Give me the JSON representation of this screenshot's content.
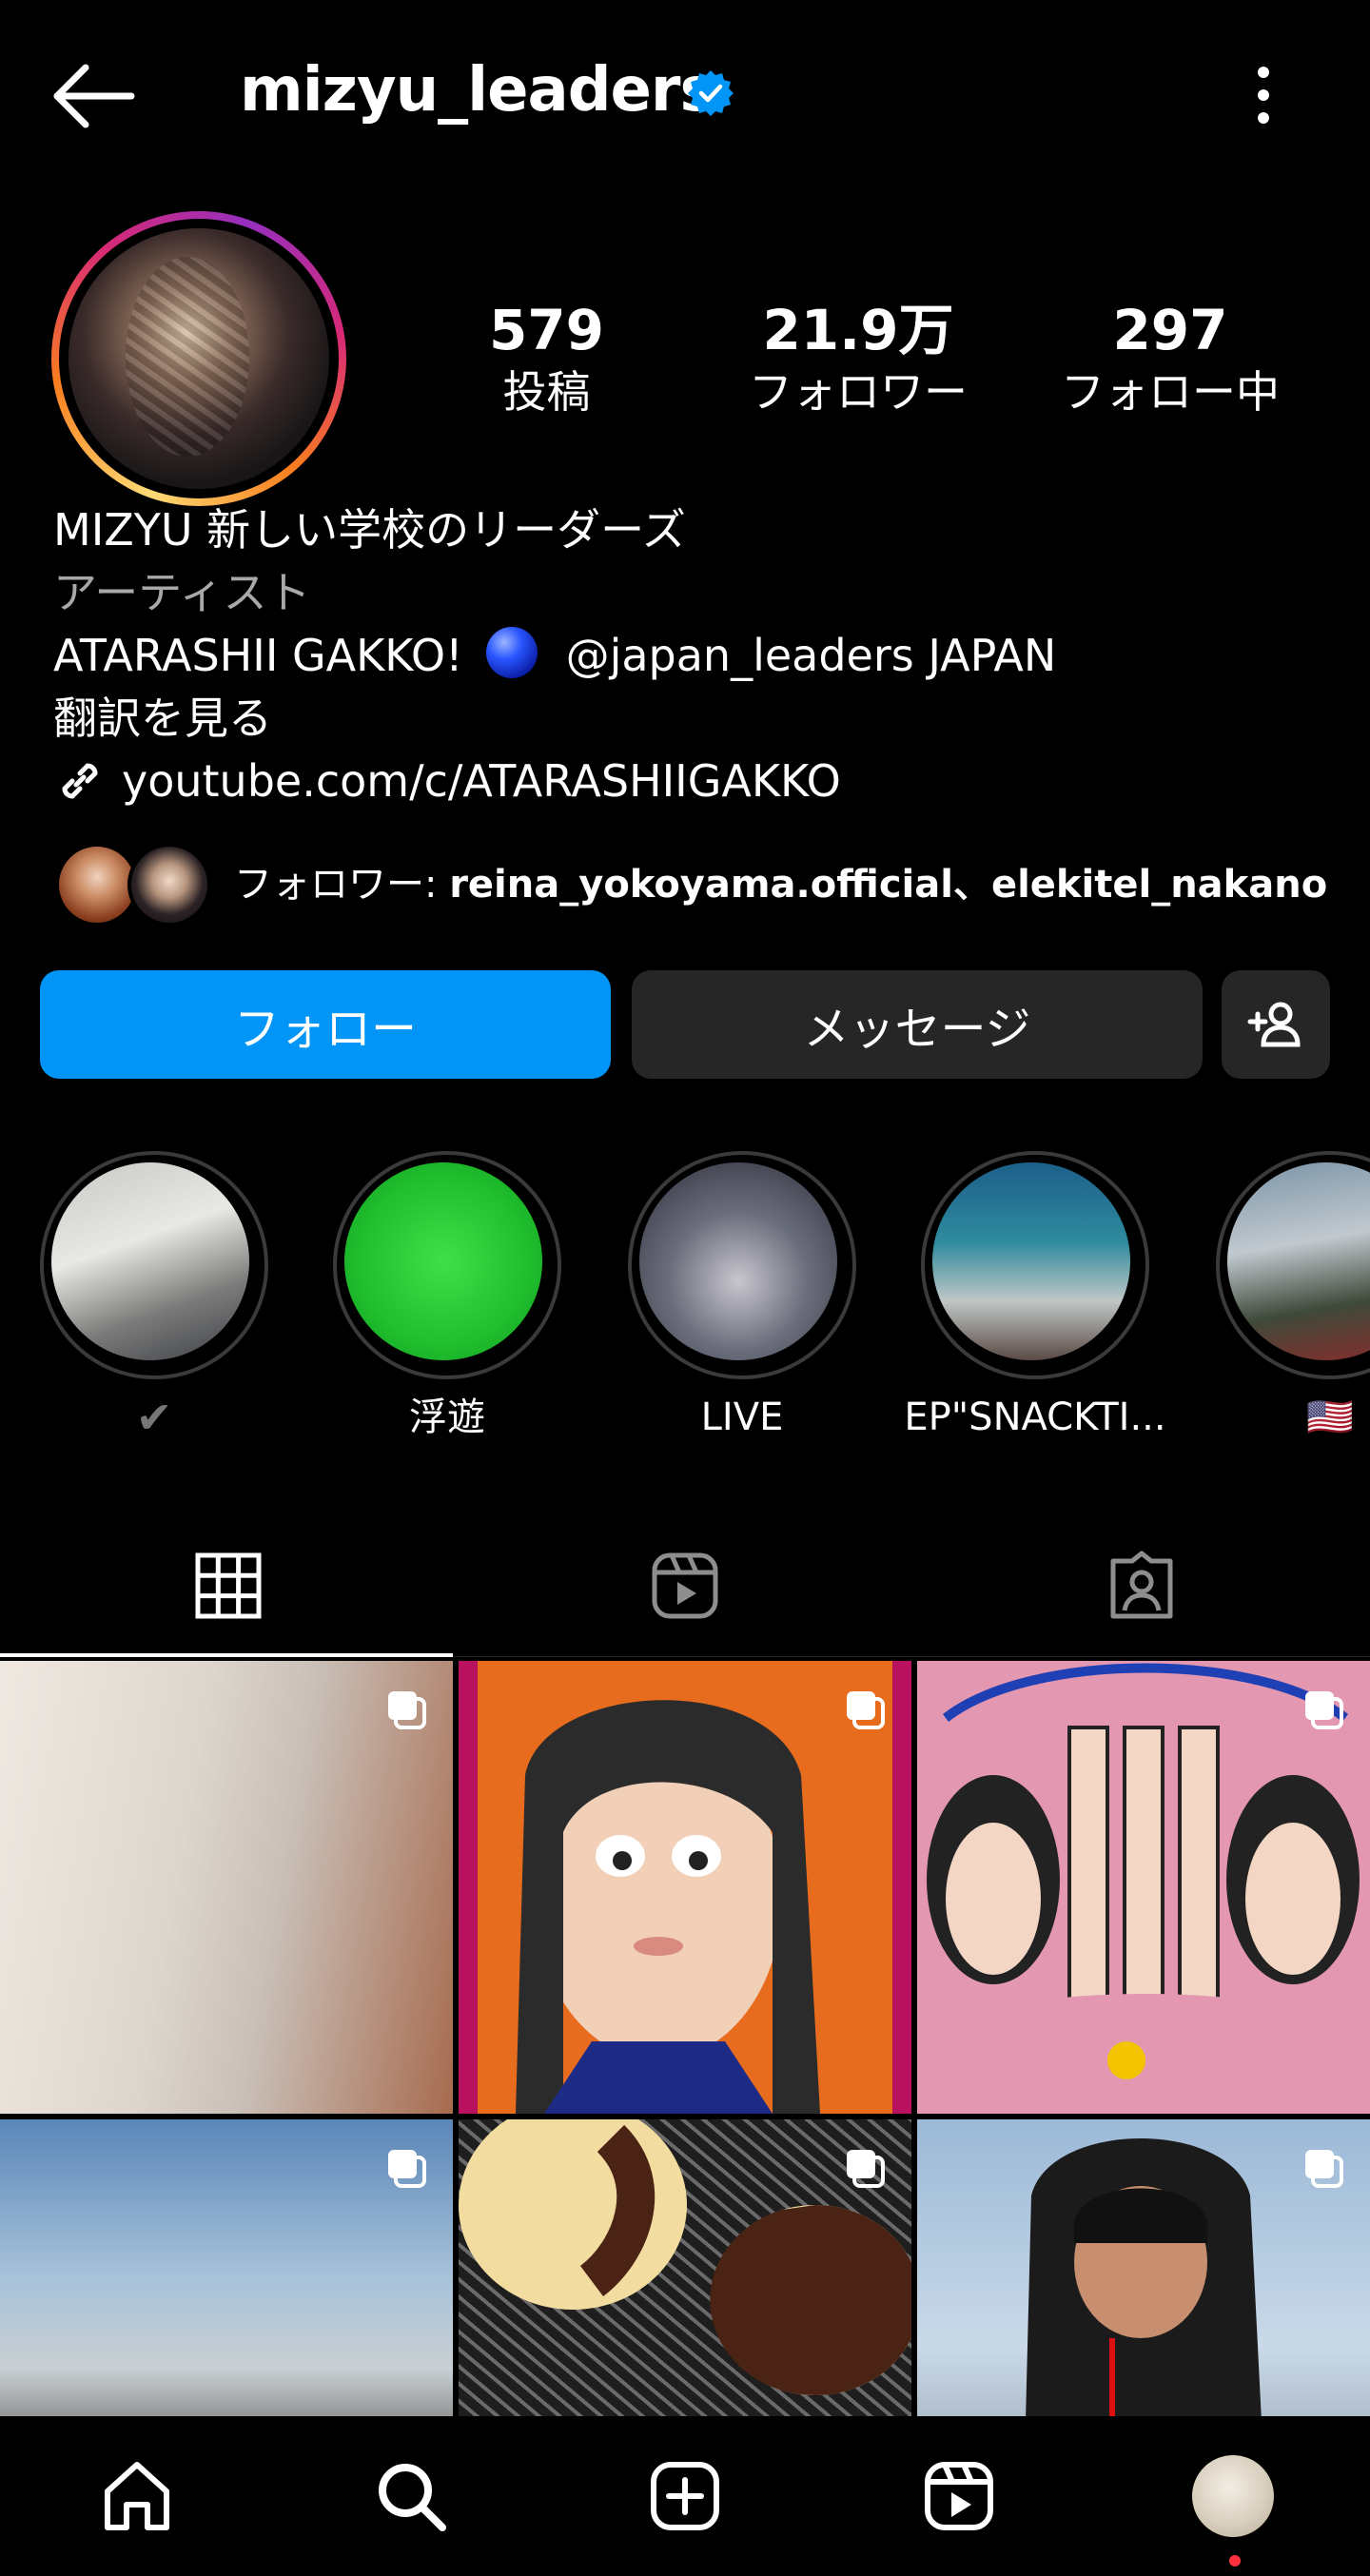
{
  "header": {
    "username": "mizyu_leaders",
    "verified": true,
    "back_icon": "arrow-left-icon",
    "more_icon": "vertical-dots-icon"
  },
  "profile": {
    "stats": [
      {
        "value": "579",
        "label": "投稿"
      },
      {
        "value": "21.9万",
        "label": "フォロワー"
      },
      {
        "value": "297",
        "label": "フォロー中"
      }
    ],
    "bio": {
      "name": "MIZYU  新しい学校のリーダーズ",
      "category": "アーティスト",
      "line_a": "ATARASHII GAKKO!",
      "line_b": "@japan_leaders JAPAN",
      "translate": "翻訳を見る",
      "link": "youtube.com/c/ATARASHIIGAKKO"
    },
    "mutual": {
      "prefix": "フォロワー: ",
      "names": "reina_yokoyama.official、elekitel_nakano"
    }
  },
  "actions": {
    "follow": "フォロー",
    "message": "メッセージ"
  },
  "highlights": [
    {
      "label": "✔"
    },
    {
      "label": "浮遊"
    },
    {
      "label": "LIVE"
    },
    {
      "label": "EP\"SNACKTI..."
    },
    {
      "label": "🇺🇸"
    }
  ],
  "tabs": [
    "grid-icon",
    "reels-icon",
    "tagged-icon"
  ],
  "colors": {
    "accent": "#0095f6",
    "button_bg": "#262626",
    "muted_text": "#a8a8a8",
    "notification": "#ff3040"
  }
}
